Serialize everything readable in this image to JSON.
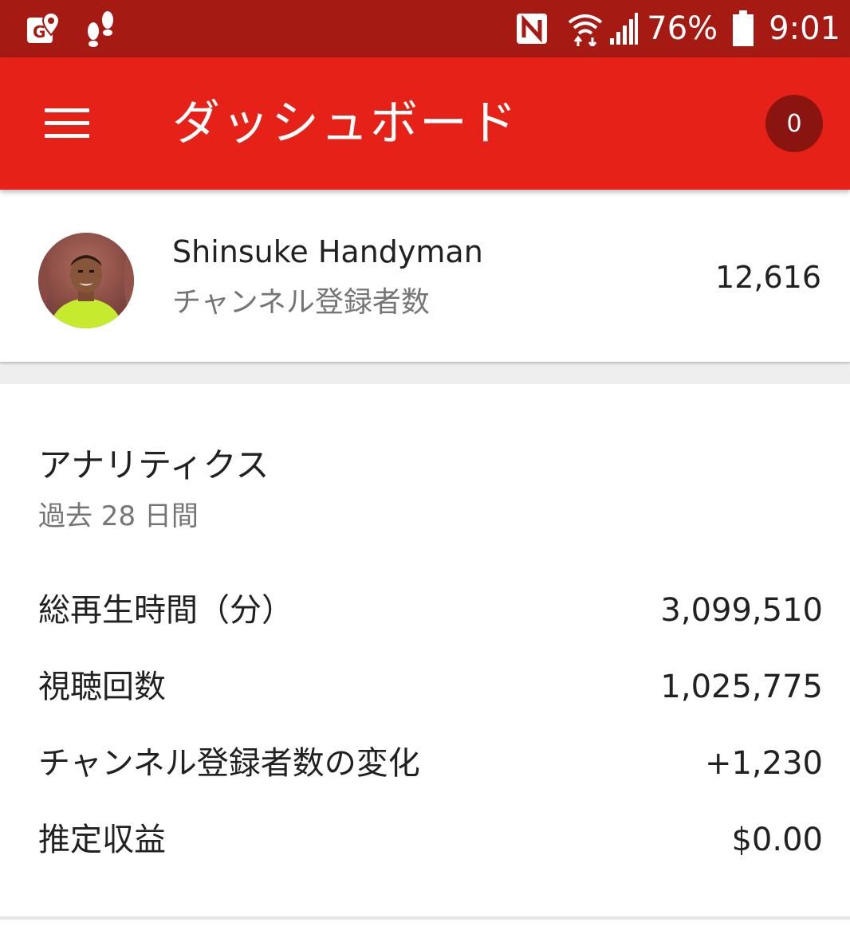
{
  "status_bar": {
    "battery_percent": "76%",
    "time": "9:01",
    "left_icons": [
      "maps-location-icon",
      "footsteps-icon"
    ],
    "right_icons": [
      "nfc-icon",
      "wifi-icon",
      "cell-signal-icon",
      "battery-icon"
    ],
    "background_color": "#a61a14"
  },
  "app_bar": {
    "title": "ダッシュボード",
    "notification_count": "0",
    "background_color": "#e62117",
    "badge_color": "#8a1510",
    "menu_icon": "hamburger-menu-icon"
  },
  "channel": {
    "name": "Shinsuke Handyman",
    "subscriber_label": "チャンネル登録者数",
    "subscriber_count": "12,616"
  },
  "analytics": {
    "title": "アナリティクス",
    "period": "過去 28 日間",
    "metrics": [
      {
        "label": "総再生時間（分）",
        "value": "3,099,510"
      },
      {
        "label": "視聴回数",
        "value": "1,025,775"
      },
      {
        "label": "チャンネル登録者数の変化",
        "value": "+1,230"
      },
      {
        "label": "推定収益",
        "value": "$0.00"
      }
    ]
  }
}
